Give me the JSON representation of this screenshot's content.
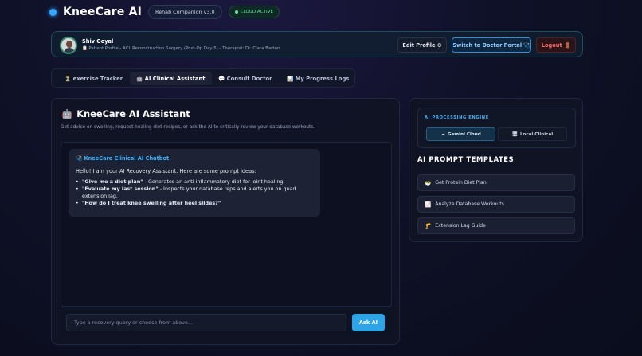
{
  "header": {
    "brand": "KneeCare AI",
    "version_badge": "Rehab Companion v3.0",
    "status_badge": "CLOUD ACTIVE"
  },
  "profile": {
    "name": "Shiv Goyal",
    "subtitle": "📋 Patient Profile - ACL Reconstruction Surgery (Post-Op Day 5) - Therapist: Dr. Clara Barton",
    "edit_label": "Edit Profile ⚙",
    "doctor_portal_label": "Switch to Doctor Portal 🩺",
    "logout_label": "Logout 🚪"
  },
  "tabs": [
    {
      "icon": "⏳",
      "label": "exercise Tracker",
      "active": false
    },
    {
      "icon": "🤖",
      "label": "AI Clinical Assistant",
      "active": true
    },
    {
      "icon": "💬",
      "label": "Consult Doctor",
      "active": false
    },
    {
      "icon": "📊",
      "label": "My Progress Logs",
      "active": false
    }
  ],
  "main": {
    "title_icon": "🤖",
    "title": "KneeCare AI Assistant",
    "subtitle": "Get advice on swelling, request healing diet recipes, or ask the AI to critically review your database workouts.",
    "chat": {
      "bot_title": "🩺 KneeCare Clinical AI Chatbot",
      "intro": "Hello! I am your AI Recovery Assistant. Here are some prompt ideas:",
      "items": [
        {
          "bold": "\"Give me a diet plan\"",
          "text": " - Generates an anti-inflammatory diet for joint healing."
        },
        {
          "bold": "\"Evaluate my last session\"",
          "text": " - Inspects your database reps and alerts you on quad extension lag."
        },
        {
          "bold": "\"How do I treat knee swelling after heel slides?\"",
          "text": ""
        }
      ]
    },
    "input_placeholder": "Type a recovery query or choose from above...",
    "ask_label": "Ask AI"
  },
  "side": {
    "engine_label": "AI PROCESSING ENGINE",
    "engine_options": [
      {
        "icon": "☁",
        "label": "Gemini Cloud",
        "active": true
      },
      {
        "icon": "🖥",
        "label": "Local Clinical",
        "active": false
      }
    ],
    "templates_title": "AI PROMPT TEMPLATES",
    "templates": [
      {
        "icon": "🥗",
        "label": "Get Protein Diet Plan"
      },
      {
        "icon": "📈",
        "label": "Analyze Database Workouts"
      },
      {
        "icon": "🦵",
        "label": "Extension Lag Guide"
      }
    ]
  },
  "colors": {
    "accent": "#2ea4e8",
    "status_green": "#5fe3a1",
    "logout_red": "#ff6b6b",
    "background": "#0f1128"
  }
}
